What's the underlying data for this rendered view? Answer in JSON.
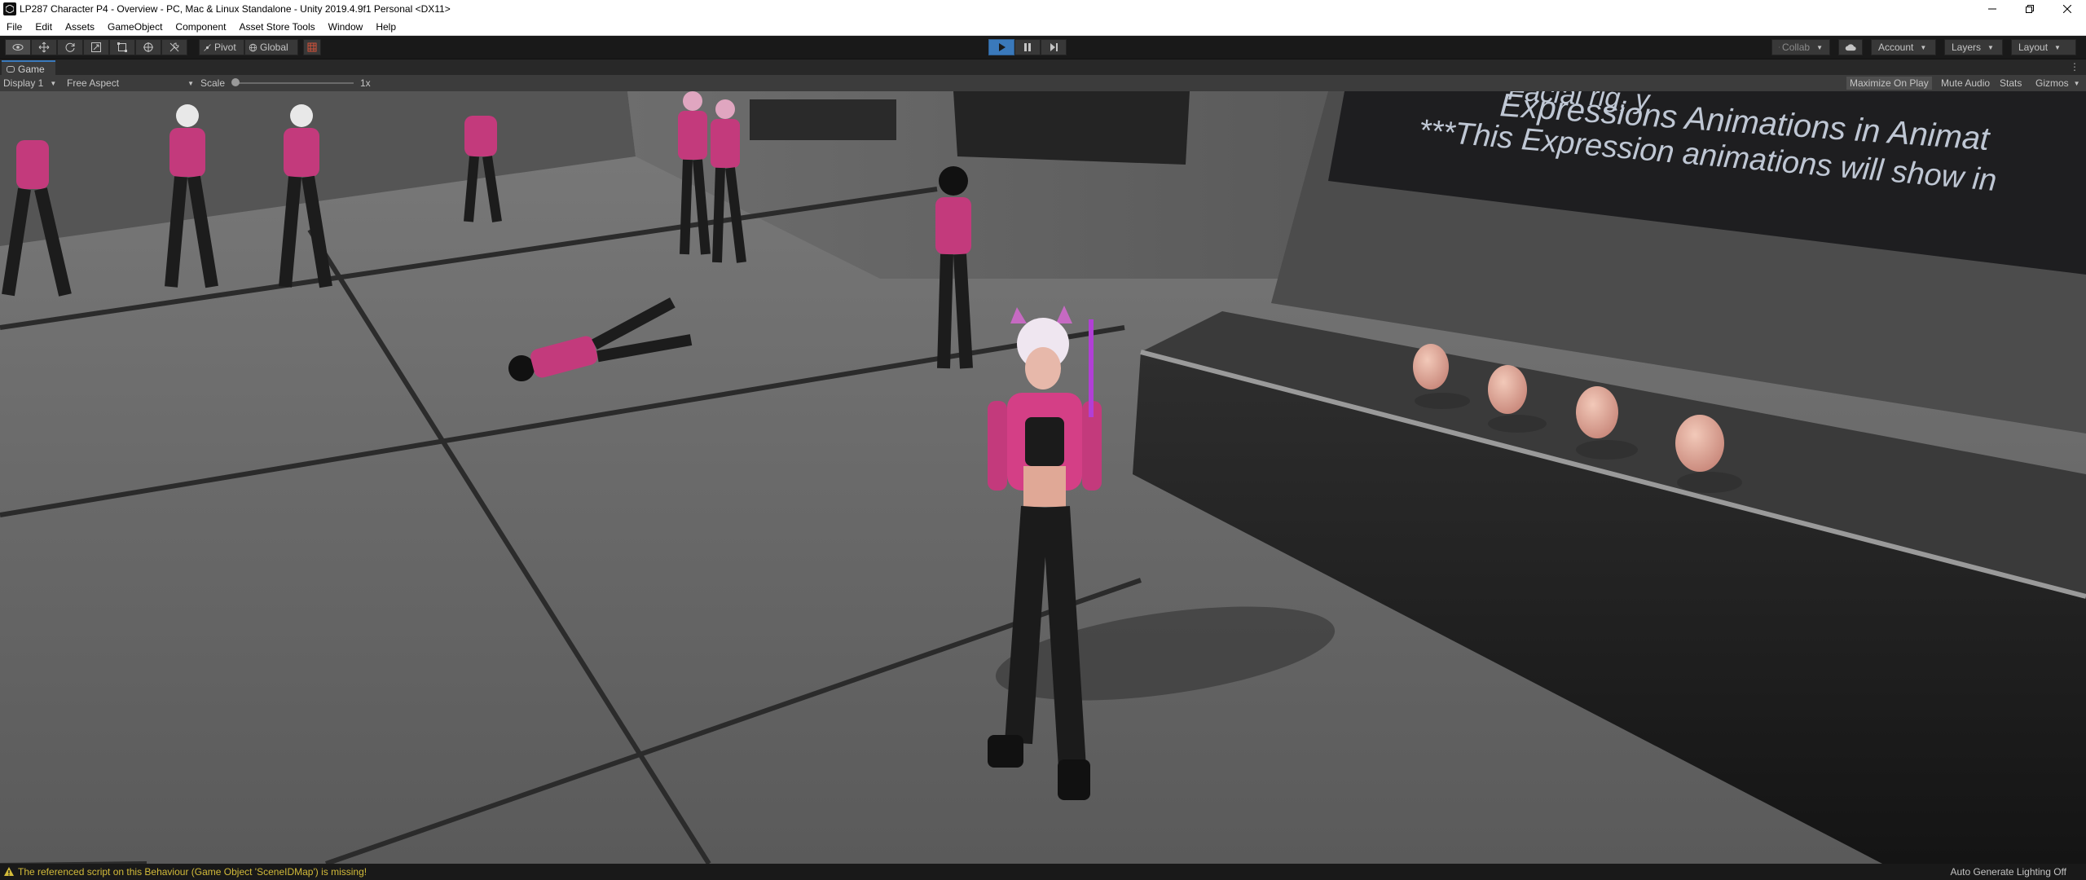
{
  "window": {
    "title": "LP287 Character P4 - Overview - PC, Mac & Linux Standalone - Unity 2019.4.9f1 Personal <DX11>",
    "controls": [
      "minimize",
      "restore",
      "close"
    ]
  },
  "menu": [
    "File",
    "Edit",
    "Assets",
    "GameObject",
    "Component",
    "Asset Store Tools",
    "Window",
    "Help"
  ],
  "toolbar": {
    "tools": [
      "view-tool",
      "move-tool",
      "rotate-tool",
      "scale-tool",
      "rect-tool",
      "transform-tool",
      "custom-tool"
    ],
    "pivot_label": "Pivot",
    "global_label": "Global",
    "play": "play",
    "pause": "pause",
    "step": "step",
    "collab_label": "Collab",
    "account_label": "Account",
    "layers_label": "Layers",
    "layout_label": "Layout"
  },
  "game_tab": {
    "label": "Game"
  },
  "game_bar": {
    "display_label": "Display 1",
    "aspect_label": "Free Aspect",
    "scale_label": "Scale",
    "scale_value": "1x",
    "maximize_label": "Maximize On Play",
    "mute_label": "Mute Audio",
    "stats_label": "Stats",
    "gizmos_label": "Gizmos"
  },
  "scene": {
    "sign_line1": "Expressions Animations in Animat",
    "sign_line2": "***This Expression animations will show in",
    "sign_line0": "Facial rig, y"
  },
  "status": {
    "message": "The referenced script on this Behaviour (Game Object 'SceneIDMap') is missing!",
    "right": "Auto Generate Lighting Off"
  },
  "colors": {
    "toolbar_bg": "#191919",
    "panel_bg": "#3c3c3c",
    "play_active": "#3a79bb",
    "warning": "#d3bb3a",
    "character_pink": "#d43f86"
  }
}
